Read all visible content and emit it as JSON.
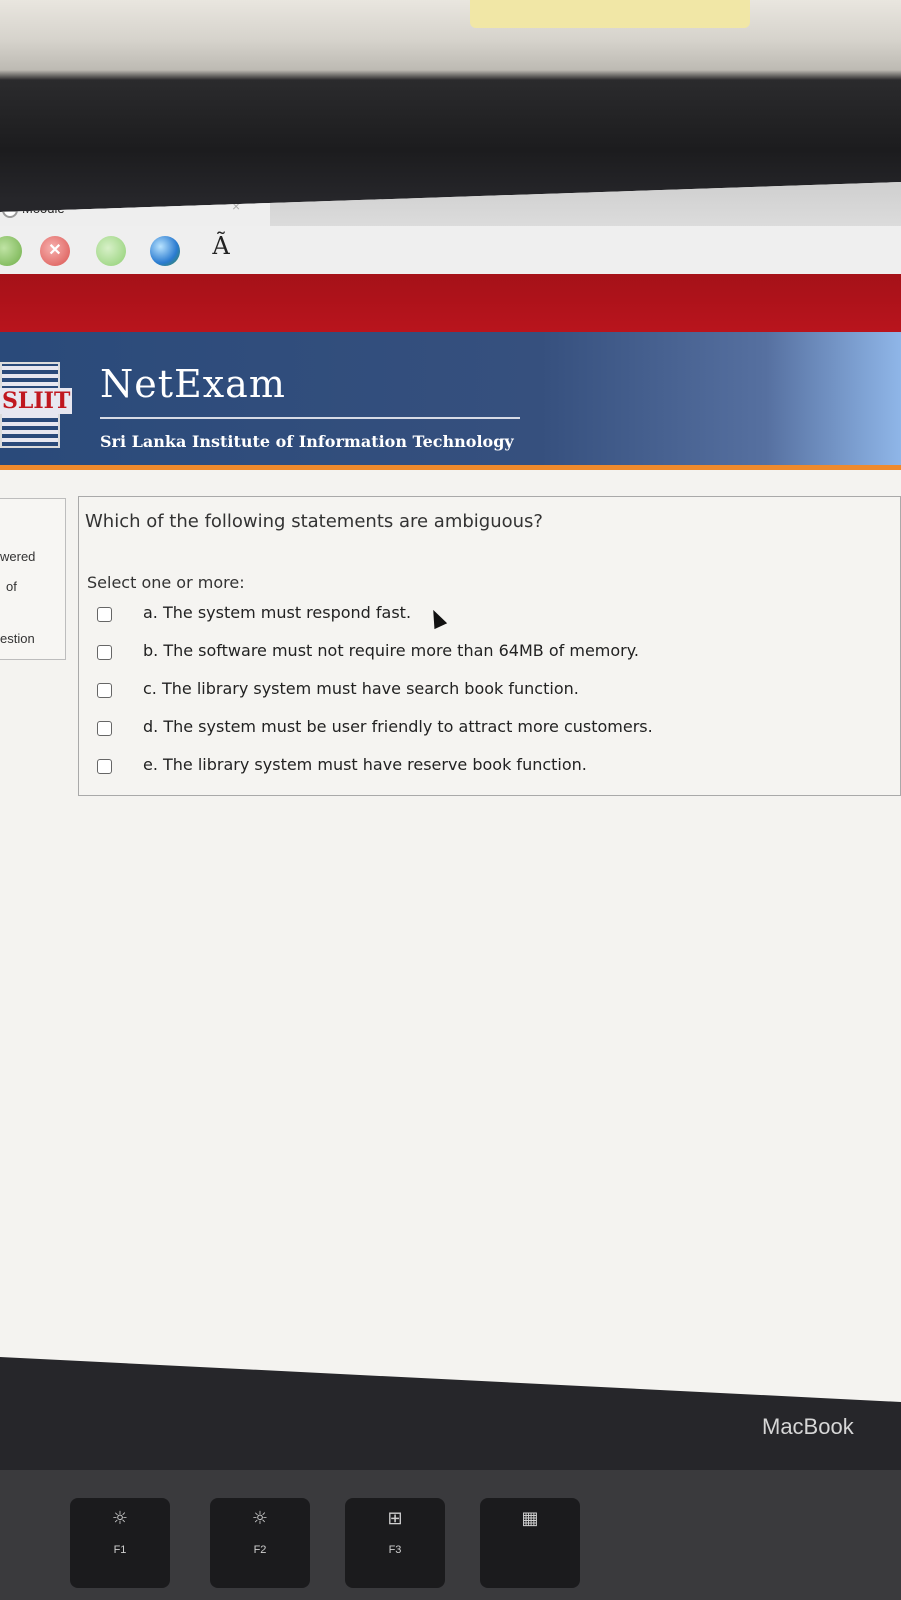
{
  "browser": {
    "tab_title": "Moodle",
    "tab_close": "×",
    "toolbar": {
      "stop_symbol": "✕",
      "char_button": "Ã"
    }
  },
  "header": {
    "logo_text": "SLIIT",
    "app_title": "NetExam",
    "subtitle": "Sri Lanka Institute of Information Technology"
  },
  "sidebar": {
    "items": [
      {
        "label": "wered"
      },
      {
        "label": "of"
      },
      {
        "label": "estion"
      }
    ]
  },
  "question": {
    "text": "Which of the following statements are ambiguous?",
    "prompt": "Select one or more:",
    "options": [
      {
        "label": "a. The system must respond fast.",
        "checked": false
      },
      {
        "label": "b. The software must not require more than 64MB of memory.",
        "checked": false
      },
      {
        "label": "c. The library system must have search book function.",
        "checked": false
      },
      {
        "label": "d. The system must be user friendly to attract more customers.",
        "checked": false
      },
      {
        "label": "e. The library system must have reserve book function.",
        "checked": false
      }
    ]
  },
  "device": {
    "bezel_label": "MacBook",
    "keys": [
      {
        "symbol": "☼",
        "label": "F1"
      },
      {
        "symbol": "☼",
        "label": "F2"
      },
      {
        "symbol": "⊞",
        "label": "F3"
      },
      {
        "symbol": "▦",
        "label": ""
      }
    ]
  }
}
